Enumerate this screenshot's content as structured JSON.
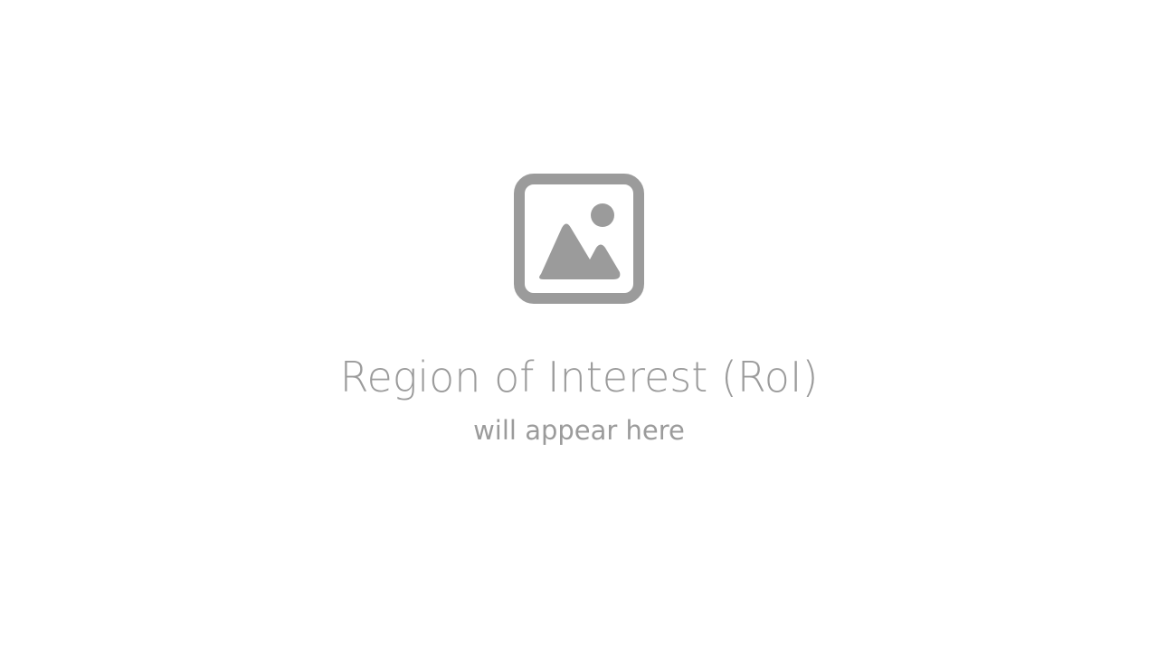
{
  "placeholder": {
    "icon": "image-placeholder-icon",
    "title": "Region of Interest (RoI)",
    "subtitle": "will appear here"
  },
  "colors": {
    "background": "#ffffff",
    "foreground": "#9b9b9b"
  }
}
